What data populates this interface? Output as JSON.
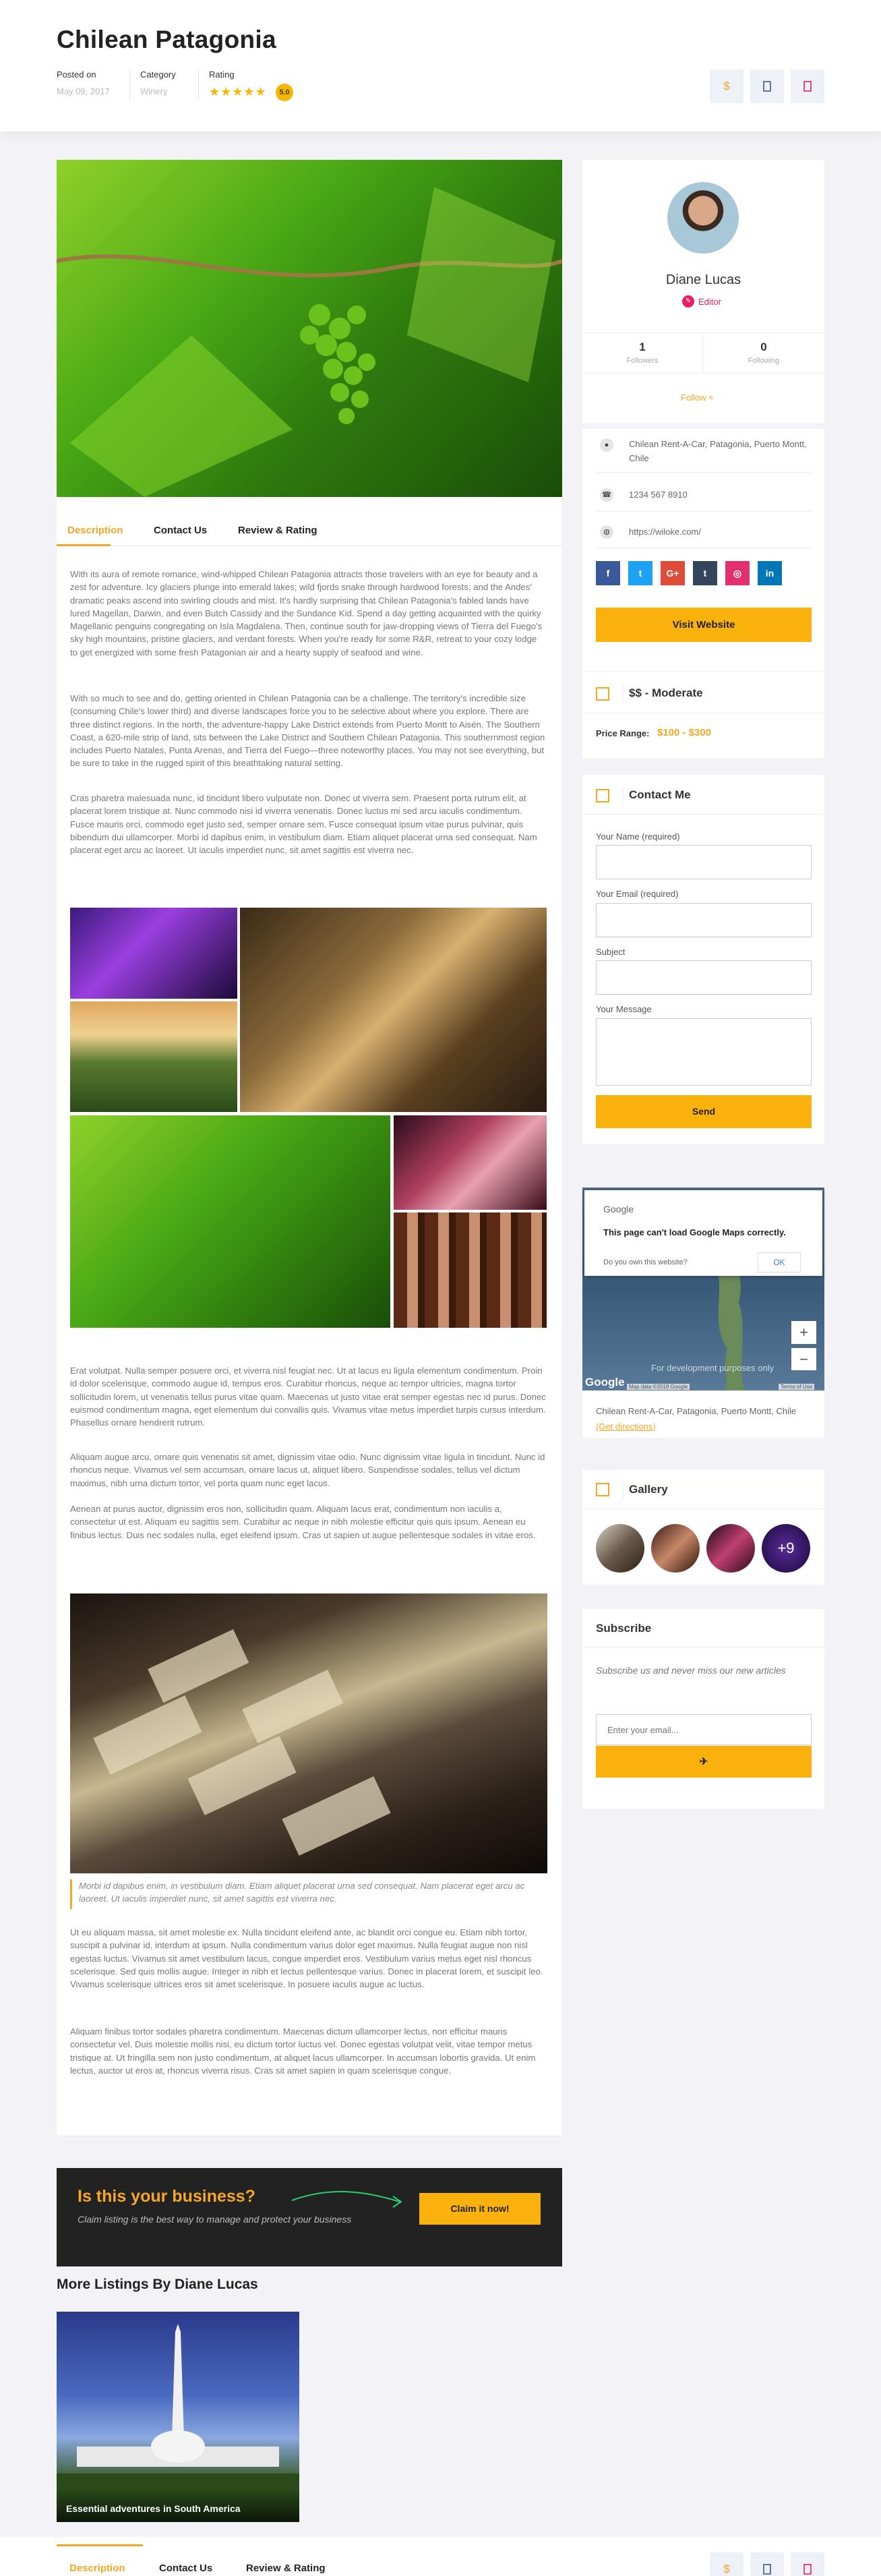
{
  "header": {
    "title": "Chilean Patagonia",
    "posted_label": "Posted on",
    "posted_value": "May 09, 2017",
    "category_label": "Category",
    "category_value": "Winery",
    "rating_label": "Rating",
    "rating_stars": "★★★★★",
    "rating_value": "5.0",
    "share_label": "$"
  },
  "tabs": {
    "description": "Description",
    "contact": "Contact Us",
    "review": "Review & Rating"
  },
  "description": {
    "p1": "With its aura of remote romance, wind-whipped Chilean Patagonia attracts those travelers with an eye for beauty and a zest for adventure. Icy glaciers plunge into emerald lakes; wild fjords snake through hardwood forests; and the Andes' dramatic peaks ascend into swirling clouds and mist. It's hardly surprising that Chilean Patagonia's fabled lands have lured Magellan, Darwin, and even Butch Cassidy and the Sundance Kid. Spend a day getting acquainted with the quirky Magellanic penguins congregating on Isla Magdalena. Then, continue south for jaw-dropping views of Tierra del Fuego's sky high mountains, pristine glaciers, and verdant forests. When you're ready for some R&R, retreat to your cozy lodge to get energized with some fresh Patagonian air and a hearty supply of seafood and wine.",
    "p2": "With so much to see and do, getting oriented in Chilean Patagonia can be a challenge. The territory's incredible size (consuming Chile's lower third) and diverse landscapes force you to be selective about where you explore. There are three distinct regions. In the north, the adventure-happy Lake District extends from Puerto Montt to Aisén. The Southern Coast, a 620-mile strip of land, sits between the Lake District and Southern Chilean Patagonia. This southernmost region includes Puerto Natales, Punta Arenas, and Tierra del Fuego—three noteworthy places. You may not see everything, but be sure to take in the rugged spirit of this breathtaking natural setting.",
    "p3": "Cras pharetra malesuada nunc, id tincidunt libero vulputate non. Donec ut viverra sem. Praesent porta rutrum elit, at placerat lorem tristique at. Nunc commodo nisi id viverra venenatis. Donec luctus mi sed arcu iaculis condimentum. Fusce mauris orci, commodo eget justo sed, semper ornare sem. Fusce consequat ipsum vitae purus pulvinar, quis bibendum dui ullamcorper. Morbi id dapibus enim, in vestibulum diam. Etiam aliquet placerat urna sed consequat. Nam placerat eget arcu ac laoreet. Ut iaculis imperdiet nunc, sit amet sagittis est viverra nec.",
    "p4": "Erat volutpat. Nulla semper posuere orci, et viverra nisl feugiat nec. Ut at lacus eu ligula elementum condimentum. Proin id dolor scelerisque, commodo augue id, tempus eros. Curabitur rhoncus, neque ac tempor ultricies, magna tortor sollicitudin lorem, ut venenatis tellus purus vitae quam. Maecenas ut justo vitae erat semper egestas nec id purus. Donec euismod condimentum magna, eget elementum dui convallis quis. Vivamus vitae metus imperdiet turpis cursus interdum. Phasellus ornare hendrerit rutrum.",
    "p5": "Aliquam augue arcu, ornare quis venenatis sit amet, dignissim vitae odio. Nunc dignissim vitae ligula in tincidunt. Nunc id rhoncus neque. Vivamus vel sem accumsan, ornare lacus ut, aliquet libero. Suspendisse sodales, tellus vel dictum maximus, nibh urna dictum tortor, vel porta quam nunc eget lacus.",
    "p6": "Aenean at purus auctor, dignissim eros non, sollicitudin quam. Aliquam lacus erat, condimentum non iaculis a, consectetur ut est. Aliquam eu sagittis sem. Curabitur ac neque in nibh molestie efficitur quis quis ipsum. Aenean eu finibus lectus. Duis nec sodales nulla, eget eleifend ipsum. Cras ut sapien ut augue pellentesque sodales in vitae eros.",
    "quote": "Morbi id dapibus enim, in vestibulum diam. Etiam aliquet placerat urna sed consequat. Nam placerat eget arcu ac laoreet. Ut iaculis imperdiet nunc, sit amet sagittis est viverra nec.",
    "p7": "Ut eu aliquam massa, sit amet molestie ex. Nulla tincidunt eleifend ante, ac blandit orci congue eu. Etiam nibh tortor, suscipit a pulvinar id, interdum at ipsum. Nulla condimentum varius dolor eget maximus. Nulla feugiat augue non nisl egestas luctus. Vivamus sit amet vestibulum lacus, congue imperdiet eros. Vestibulum varius metus eget nisl rhoncus scelerisque. Sed quis mollis augue. Integer in nibh et lectus pellentesque varius. Donec in placerat lorem, et suscipit leo. Vivamus scelerisque ultrices eros sit amet scelerisque. In posuere iaculis augue ac luctus.",
    "p8": "Aliquam finibus tortor sodales pharetra condimentum. Maecenas dictum ullamcorper lectus, non efficitur mauris consectetur vel. Duis molestie mollis nisi, eu dictum tortor luctus vel. Donec egestas volutpat velit, vitae tempor metus tristique at. Ut fringilla sem non justo condimentum, at aliquet lacus ullamcorper. In accumsan lobortis gravida. Ut enim lectus, auctor ut eros at, rhoncus viverra risus. Cras sit amet sapien in quam scelerisque congue."
  },
  "claim": {
    "title": "Is this your business?",
    "subtitle": "Claim listing is the best way to manage and protect your business",
    "button": "Claim it now!"
  },
  "more": {
    "title": "More Listings By Diane Lucas",
    "card_title": "Essential adventures in South America"
  },
  "author": {
    "name": "Diane Lucas",
    "role": "Editor",
    "followers": "1",
    "followers_label": "Followers",
    "following": "0",
    "following_label": "Following",
    "follow": "Follow"
  },
  "info": {
    "address": "Chilean Rent-A-Car, Patagonia, Puerto Montt, Chile",
    "phone": "1234 567 8910",
    "website": "https://wiloke.com/",
    "visit_button": "Visit Website"
  },
  "social": {
    "facebook": "f",
    "twitter": "t",
    "google": "G+",
    "tumblr": "t",
    "instagram": "◎",
    "linkedin": "in"
  },
  "price": {
    "title": "$$ - Moderate",
    "range_label": "Price Range:",
    "range_value": "$100 - $300"
  },
  "contact": {
    "title": "Contact Me",
    "name_label": "Your Name (required)",
    "email_label": "Your Email (required)",
    "subject_label": "Subject",
    "message_label": "Your Message",
    "send": "Send"
  },
  "map": {
    "brand": "Google",
    "error": "This page can't load Google Maps correctly.",
    "own_question": "Do you own this website?",
    "ok": "OK",
    "dev_note": "For development purposes only",
    "attribution": "Map data ©2018 Google",
    "terms": "Terms of Use",
    "address": "Chilean Rent-A-Car, Patagonia, Puerto Montt, Chile",
    "directions": "(Get directions)",
    "google_logo": "Google",
    "plus": "+",
    "minus": "−"
  },
  "gallery": {
    "title": "Gallery",
    "more": "+9"
  },
  "subscribe": {
    "title": "Subscribe",
    "text": "Subscribe us and never miss our new articles",
    "placeholder": "Enter your email..."
  },
  "colors": {
    "accent": "#f5a623",
    "yellow": "#f9b10c",
    "dark": "#222222",
    "pink": "#e91e63"
  }
}
